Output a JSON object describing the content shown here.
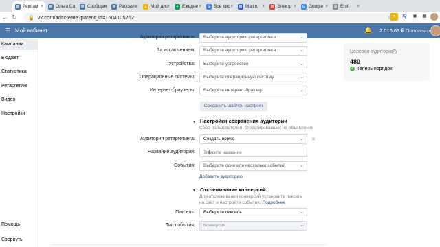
{
  "browser": {
    "tabs": [
      {
        "label": "Реклам",
        "icon": "vk-icon",
        "color": "#4a76a8",
        "glyph": "W",
        "active": true
      },
      {
        "label": "Ольга Са",
        "icon": "vk-icon",
        "color": "#4a76a8",
        "glyph": "W",
        "active": false
      },
      {
        "label": "Сообщен",
        "icon": "vk-icon",
        "color": "#4a76a8",
        "glyph": "W",
        "active": false
      },
      {
        "label": "Рассылк",
        "icon": "vk-icon",
        "color": "#4a76a8",
        "glyph": "W",
        "active": false
      },
      {
        "label": "Мой дис",
        "icon": "drive-icon",
        "color": "#f4b400",
        "glyph": "▲",
        "active": false
      },
      {
        "label": "Ежедне",
        "icon": "sheets-icon",
        "color": "#0f9d58",
        "glyph": "+",
        "active": false
      },
      {
        "label": "Все дис",
        "icon": "google-icon",
        "color": "#4285f4",
        "glyph": "G",
        "active": false
      },
      {
        "label": "Mail.ru",
        "icon": "mailru-icon",
        "color": "#2b59c3",
        "glyph": "M",
        "active": false
      },
      {
        "label": "Электр",
        "icon": "mail-icon",
        "color": "#d14836",
        "glyph": "M",
        "active": false
      },
      {
        "label": "Google",
        "icon": "google-icon",
        "color": "#4285f4",
        "glyph": "G",
        "active": false
      },
      {
        "label": "Ersh",
        "icon": "globe-icon",
        "color": "#888888",
        "glyph": "◎",
        "active": false
      }
    ],
    "url": "vk.com/adscreate?parent_id=1604105262"
  },
  "header": {
    "title": "Мой кабинет",
    "balance": "2 016,63 ₽",
    "topup": "Пополнить"
  },
  "sidebar": {
    "items": [
      "Кампании",
      "Бюджет",
      "Статистика",
      "Ретаргетинг",
      "Видео",
      "Настройки"
    ],
    "help": "Помощь",
    "collapse": "Свернуть"
  },
  "form": {
    "rows1": [
      {
        "label": "Аудитории ретаргетинга:",
        "value": "Выберите аудиторию ретаргетинга"
      },
      {
        "label": "За исключением:",
        "value": "Выберите аудиторию ретаргетинга"
      },
      {
        "label": "Устройства:",
        "value": "Выберите устройство"
      },
      {
        "label": "Операционные системы:",
        "value": "Выберите операционную систему"
      },
      {
        "label": "Интернет-браузеры:",
        "value": "Выберите интернет-браузер"
      }
    ],
    "save_template": "Сохранить шаблон настроек",
    "audience_section": {
      "title": "Настройки сохранения аудитории",
      "hint": "Сбор пользователей, отреагировавших на объявление",
      "retarget_label": "Аудитория ретаргетинга:",
      "retarget_value": "Создать новую",
      "name_label": "Название аудитории:",
      "name_placeholder": "Введите название",
      "events_label": "События:",
      "events_value": "Выберите одно или несколько событий",
      "add_link": "Добавить аудиторию"
    },
    "conversion_section": {
      "title": "Отслеживание конверсий",
      "hint_line1": "Для отслеживания конверсий установите пиксель",
      "hint_line2": "на сайт и настройте события.",
      "more_link": "Подробнее",
      "pixel_label": "Пиксель:",
      "pixel_value": "Выберите пиксель",
      "event_type_label": "Тип события:",
      "event_type_value": "Конверсия"
    }
  },
  "audience_card": {
    "title": "Целевая аудитория",
    "count": "480",
    "status": "Теперь порядок!"
  }
}
